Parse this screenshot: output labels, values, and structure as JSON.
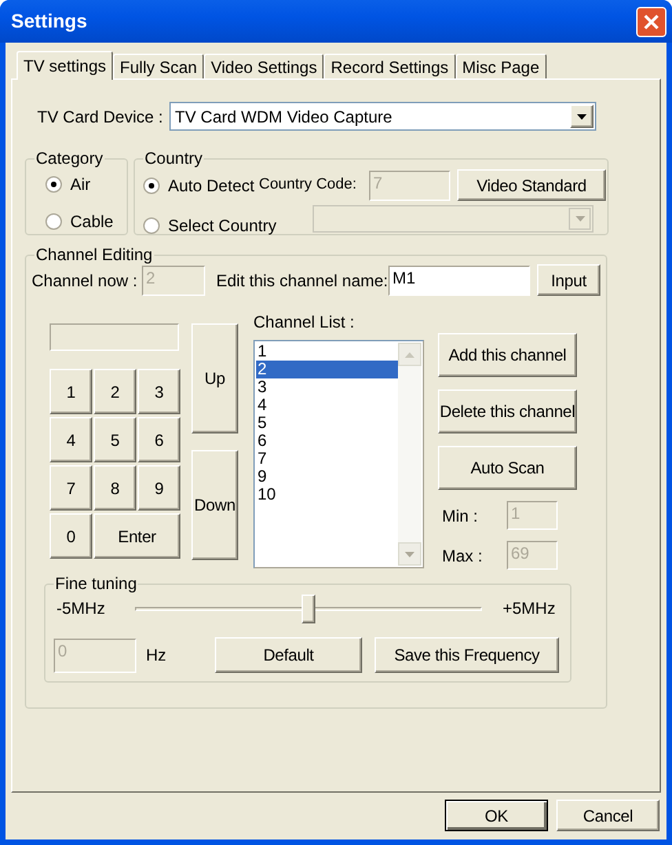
{
  "window": {
    "title": "Settings"
  },
  "tabs": [
    {
      "label": "TV settings",
      "selected": true
    },
    {
      "label": "Fully Scan",
      "selected": false
    },
    {
      "label": "Video Settings",
      "selected": false
    },
    {
      "label": "Record Settings",
      "selected": false
    },
    {
      "label": "Misc Page",
      "selected": false
    }
  ],
  "tv_card_device": {
    "label": "TV Card Device :",
    "value": "TV Card WDM Video Capture"
  },
  "category": {
    "title": "Category",
    "options": [
      {
        "label": "Air",
        "selected": true
      },
      {
        "label": "Cable",
        "selected": false
      }
    ]
  },
  "country": {
    "title": "Country",
    "options": [
      {
        "label": "Auto Detect",
        "selected": true
      },
      {
        "label": "Select Country",
        "selected": false
      }
    ],
    "country_code_label": "Country Code:",
    "country_code": "7",
    "video_standard_button": "Video Standard"
  },
  "channel_editing": {
    "title": "Channel Editing",
    "channel_now_label": "Channel now :",
    "channel_now": "2",
    "edit_name_label": "Edit this channel name:",
    "name_value": "M1",
    "input_button": "Input",
    "keypad": [
      [
        "1",
        "2",
        "3"
      ],
      [
        "4",
        "5",
        "6"
      ],
      [
        "7",
        "8",
        "9"
      ],
      [
        "0",
        "Enter"
      ]
    ],
    "up_button": "Up",
    "down_button": "Down",
    "channel_list_label": "Channel List :",
    "channels": [
      {
        "label": "1",
        "selected": false
      },
      {
        "label": "2",
        "selected": true
      },
      {
        "label": "3",
        "selected": false
      },
      {
        "label": "4",
        "selected": false
      },
      {
        "label": "5",
        "selected": false
      },
      {
        "label": "6",
        "selected": false
      },
      {
        "label": "7",
        "selected": false
      },
      {
        "label": "9",
        "selected": false
      },
      {
        "label": "10",
        "selected": false
      }
    ],
    "actions": [
      "Add this channel",
      "Delete this channel",
      "Auto Scan"
    ],
    "min_label": "Min :",
    "min": "1",
    "max_label": "Max :",
    "max": "69"
  },
  "fine_tuning": {
    "title": "Fine tuning",
    "min_label": "-5MHz",
    "max_label": "+5MHz",
    "level": 0.5,
    "hz_value": "0",
    "hz_label": "Hz",
    "buttons": [
      "Default",
      "Save this Frequency"
    ]
  },
  "buttons": [
    {
      "label": "OK",
      "default": true
    },
    {
      "label": "Cancel",
      "default": false
    }
  ]
}
